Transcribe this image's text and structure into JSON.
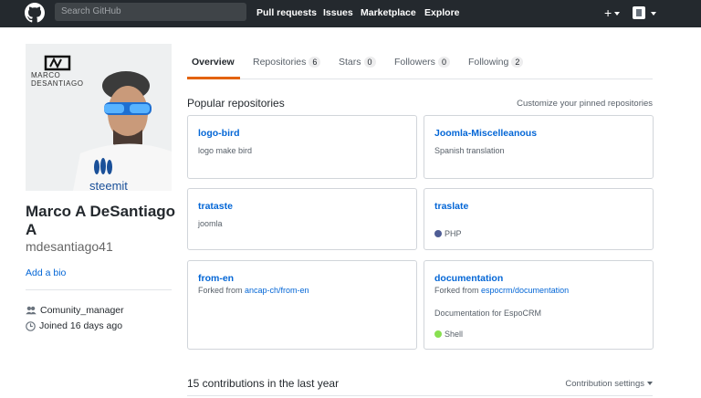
{
  "header": {
    "search_placeholder": "Search GitHub",
    "nav": [
      "Pull requests",
      "Issues",
      "Marketplace",
      "Explore"
    ],
    "plus": "+"
  },
  "profile": {
    "photo_text_top": "MARCO DESANTIAGO",
    "photo_text_brand": "steemit",
    "name": "Marco A DeSantiago A",
    "username": "mdesantiago41",
    "add_bio": "Add a bio",
    "organization": "Comunity_manager",
    "joined": "Joined 16 days ago"
  },
  "tabs": [
    {
      "label": "Overview",
      "count": ""
    },
    {
      "label": "Repositories",
      "count": "6"
    },
    {
      "label": "Stars",
      "count": "0"
    },
    {
      "label": "Followers",
      "count": "0"
    },
    {
      "label": "Following",
      "count": "2"
    }
  ],
  "popular": {
    "title": "Popular repositories",
    "customize": "Customize your pinned repositories"
  },
  "repos": [
    {
      "name": "logo-bird",
      "desc": "logo make bird",
      "forked_from": "",
      "language": "",
      "lang_color": ""
    },
    {
      "name": "Joomla-Miscelleanous",
      "desc": "Spanish translation",
      "forked_from": "",
      "language": "",
      "lang_color": ""
    },
    {
      "name": "trataste",
      "desc": "joomla",
      "forked_from": "",
      "language": "",
      "lang_color": ""
    },
    {
      "name": "traslate",
      "desc": "",
      "forked_from": "",
      "language": "PHP",
      "lang_color": "#4F5D95"
    },
    {
      "name": "from-en",
      "desc": "",
      "forked_from_prefix": "Forked from",
      "forked_from": "ancap-ch/from-en",
      "language": "",
      "lang_color": ""
    },
    {
      "name": "documentation",
      "desc": "Documentation for EspoCRM",
      "forked_from_prefix": "Forked from",
      "forked_from": "espocrm/documentation",
      "language": "Shell",
      "lang_color": "#89e051"
    }
  ],
  "contributions": {
    "title": "15 contributions in the last year",
    "settings": "Contribution settings"
  }
}
